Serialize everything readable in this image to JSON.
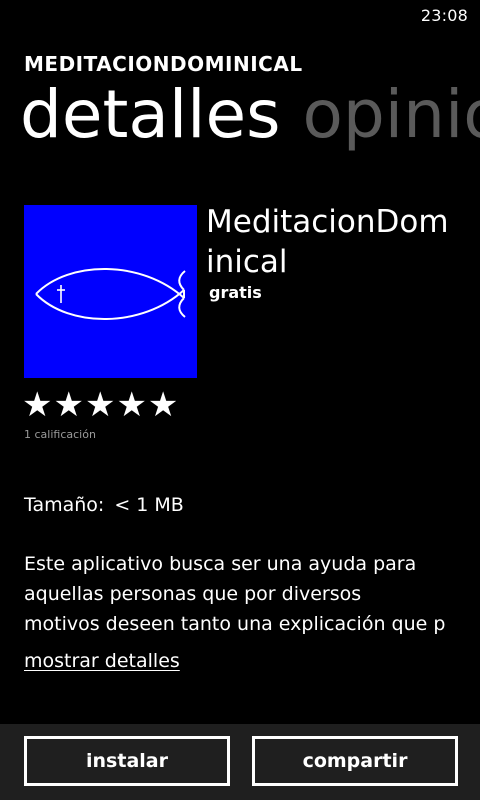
{
  "status_bar": {
    "time": "23:08"
  },
  "header": {
    "app_name": "MEDITACIONDOMINICAL"
  },
  "pivot": {
    "tabs": [
      {
        "label": "detalles",
        "active": true
      },
      {
        "label": "opiniones",
        "active": false
      }
    ]
  },
  "app": {
    "title": "MeditacionDominical",
    "price": "gratis",
    "tile_color": "#0000ff",
    "tile_icon": "fish-icon",
    "stars": "★★★★★",
    "rating": 5,
    "rating_count": "1 calificación",
    "size_label": "Tamaño:",
    "size_value": "< 1 MB",
    "description": "Este aplicativo busca ser una ayuda para\naquellas personas que por diversos\nmotivos deseen tanto una explicación que p",
    "show_details": "mostrar detalles"
  },
  "app_bar": {
    "install_label": "instalar",
    "share_label": "compartir"
  }
}
